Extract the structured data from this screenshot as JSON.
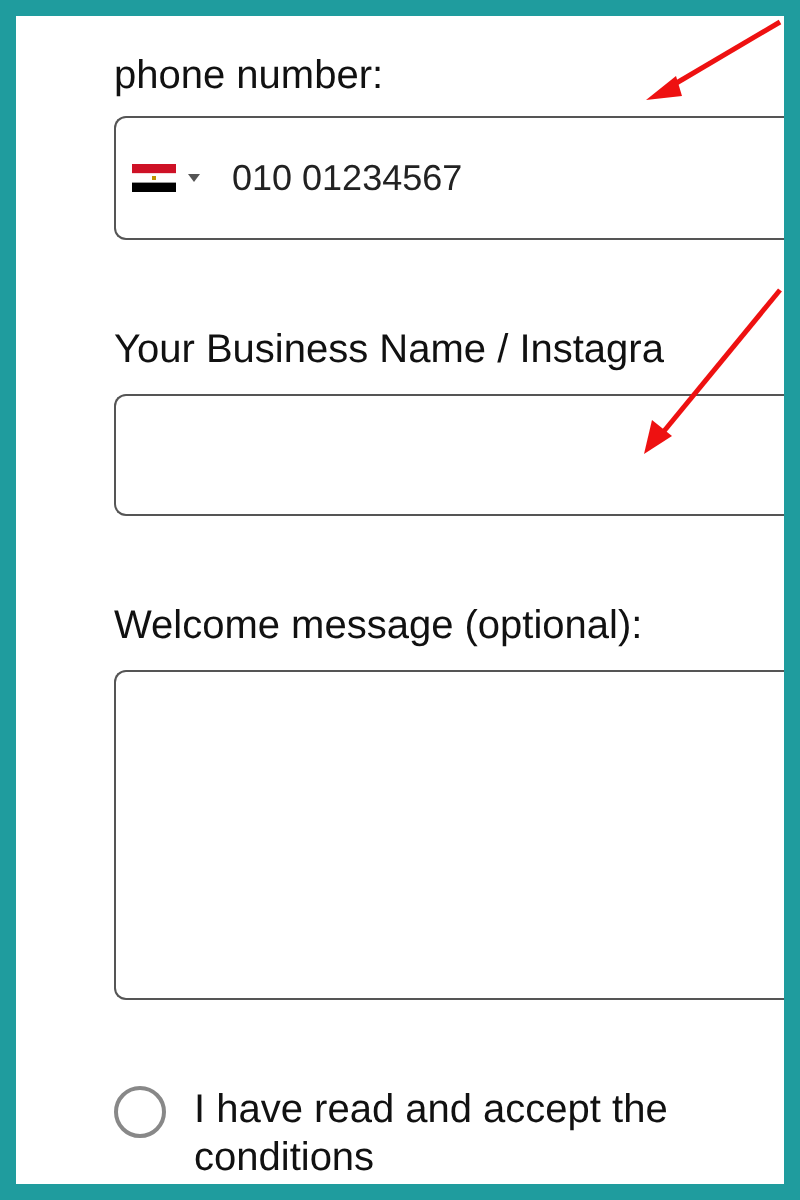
{
  "form": {
    "fields": [
      {
        "kind": "phone",
        "label": "phone number:",
        "value": "010 01234567"
      },
      {
        "kind": "text",
        "label": "Your Business Name / Instagra"
      },
      {
        "kind": "textarea",
        "label": "Welcome message (optional):"
      }
    ],
    "consent": {
      "label": "I have read and accept the conditions",
      "checked": false
    }
  }
}
